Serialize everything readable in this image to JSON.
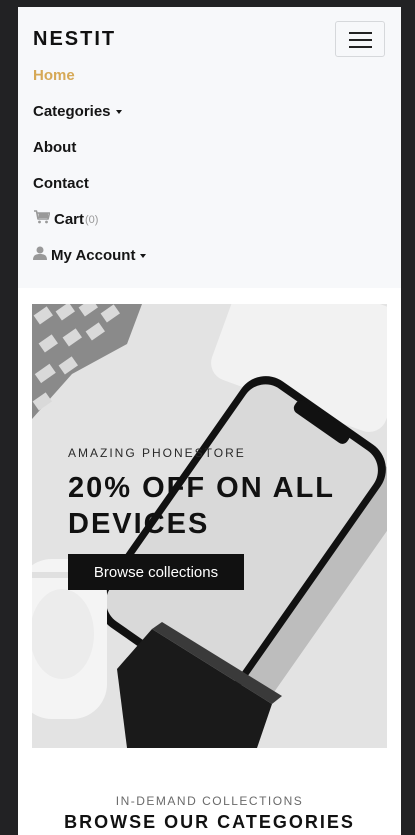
{
  "navbar": {
    "brand": "NESTIT",
    "items": [
      {
        "label": "Home",
        "active": true
      },
      {
        "label": "Categories",
        "dropdown": true
      },
      {
        "label": "About"
      },
      {
        "label": "Contact"
      },
      {
        "label": "Cart",
        "count": "(0)",
        "icon": "cart-icon"
      },
      {
        "label": "My Account",
        "dropdown": true,
        "icon": "user-icon"
      }
    ]
  },
  "hero": {
    "eyebrow": "AMAZING PHONESTORE",
    "title": "20% OFF ON ALL DEVICES",
    "button": "Browse collections"
  },
  "section": {
    "eyebrow": "IN-DEMAND COLLECTIONS",
    "title": "BROWSE OUR CATEGORIES"
  },
  "colors": {
    "accent": "#d6a957",
    "navbar_bg": "#f7f8fa",
    "button_bg": "#111111",
    "outer_bg": "#222224"
  }
}
